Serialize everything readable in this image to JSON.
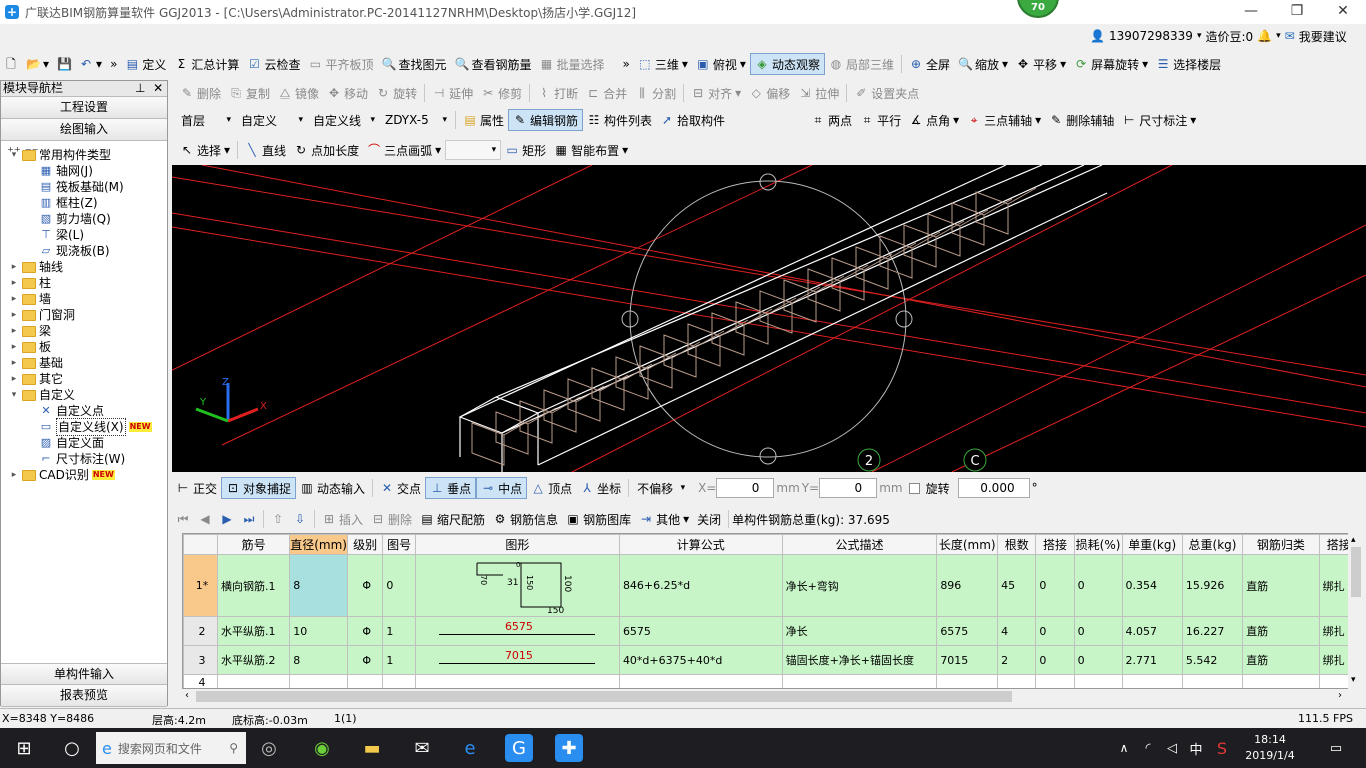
{
  "window": {
    "title": "广联达BIM钢筋算量软件 GGJ2013 - [C:\\Users\\Administrator.PC-20141127NRHM\\Desktop\\扬店小学.GGJ12]",
    "badge": "70"
  },
  "user": {
    "phone": "13907298339",
    "beans": "造价豆:0",
    "suggest": "我要建议"
  },
  "toolbar1": [
    "定义",
    "汇总计算",
    "云检查",
    "平齐板顶",
    "查找图元",
    "查看钢筋量",
    "批量选择",
    "三维",
    "俯视",
    "动态观察",
    "局部三维",
    "全屏",
    "缩放",
    "平移",
    "屏幕旋转",
    "选择楼层"
  ],
  "toolbar2": [
    "删除",
    "复制",
    "镜像",
    "移动",
    "旋转",
    "延伸",
    "修剪",
    "打断",
    "合并",
    "分割",
    "对齐",
    "偏移",
    "拉伸",
    "设置夹点"
  ],
  "toolbar3": {
    "floor": "首层",
    "type": "自定义",
    "kind": "自定义线",
    "name": "ZDYX-5",
    "items": [
      "属性",
      "编辑钢筋",
      "构件列表",
      "拾取构件"
    ],
    "aux": [
      "两点",
      "平行",
      "点角",
      "三点辅轴",
      "删除辅轴",
      "尺寸标注"
    ]
  },
  "toolbar4": [
    "选择",
    "直线",
    "点加长度",
    "三点画弧",
    "矩形",
    "智能布置"
  ],
  "nav": {
    "title": "模块导航栏",
    "btn_project": "工程设置",
    "btn_draw": "绘图输入",
    "btn_single": "单构件输入",
    "btn_report": "报表预览",
    "tree": [
      {
        "label": "常用构件类型",
        "level": 0,
        "exp": "▾",
        "kind": "folder"
      },
      {
        "label": "轴网(J)",
        "level": 1,
        "kind": "icon",
        "icon": "▦"
      },
      {
        "label": "筏板基础(M)",
        "level": 1,
        "kind": "icon",
        "icon": "▤"
      },
      {
        "label": "框柱(Z)",
        "level": 1,
        "kind": "icon",
        "icon": "▥"
      },
      {
        "label": "剪力墙(Q)",
        "level": 1,
        "kind": "icon",
        "icon": "▧"
      },
      {
        "label": "梁(L)",
        "level": 1,
        "kind": "icon",
        "icon": "⊤"
      },
      {
        "label": "现浇板(B)",
        "level": 1,
        "kind": "icon",
        "icon": "▱"
      },
      {
        "label": "轴线",
        "level": 0,
        "exp": "▸",
        "kind": "folder"
      },
      {
        "label": "柱",
        "level": 0,
        "exp": "▸",
        "kind": "folder"
      },
      {
        "label": "墙",
        "level": 0,
        "exp": "▸",
        "kind": "folder"
      },
      {
        "label": "门窗洞",
        "level": 0,
        "exp": "▸",
        "kind": "folder"
      },
      {
        "label": "梁",
        "level": 0,
        "exp": "▸",
        "kind": "folder"
      },
      {
        "label": "板",
        "level": 0,
        "exp": "▸",
        "kind": "folder"
      },
      {
        "label": "基础",
        "level": 0,
        "exp": "▸",
        "kind": "folder"
      },
      {
        "label": "其它",
        "level": 0,
        "exp": "▸",
        "kind": "folder"
      },
      {
        "label": "自定义",
        "level": 0,
        "exp": "▾",
        "kind": "folder"
      },
      {
        "label": "自定义点",
        "level": 1,
        "kind": "icon",
        "icon": "✕"
      },
      {
        "label": "自定义线(X)",
        "level": 1,
        "kind": "icon",
        "icon": "▭",
        "new": "NEW",
        "selected": true
      },
      {
        "label": "自定义面",
        "level": 1,
        "kind": "icon",
        "icon": "▨"
      },
      {
        "label": "尺寸标注(W)",
        "level": 1,
        "kind": "icon",
        "icon": "⌐"
      },
      {
        "label": "CAD识别",
        "level": 0,
        "exp": "▸",
        "kind": "folder",
        "new": "NEW"
      }
    ]
  },
  "snap": {
    "items": [
      "正交",
      "对象捕捉",
      "动态输入",
      "交点",
      "垂点",
      "中点",
      "顶点",
      "坐标"
    ],
    "offset": "不偏移",
    "x_label": "X=",
    "x_val": "0",
    "y_label": "Y=",
    "y_val": "0",
    "unit": "mm",
    "rotate": "旋转",
    "rot_val": "0.000",
    "deg": "°"
  },
  "gridtools": {
    "items": [
      "插入",
      "删除",
      "缩尺配筋",
      "钢筋信息",
      "钢筋图库",
      "其他",
      "关闭"
    ],
    "total": "单构件钢筋总重(kg): 37.695"
  },
  "table": {
    "headers": [
      "",
      "筋号",
      "直径(mm)",
      "级别",
      "图号",
      "图形",
      "计算公式",
      "公式描述",
      "长度(mm)",
      "根数",
      "搭接",
      "损耗(%)",
      "单重(kg)",
      "总重(kg)",
      "钢筋归类",
      "搭接"
    ],
    "rows": [
      [
        "1*",
        "横向钢筋.1",
        "8",
        "Φ",
        "0",
        "",
        "846+6.25*d",
        "净长+弯钩",
        "896",
        "45",
        "0",
        "0",
        "0.354",
        "15.926",
        "直筋",
        "绑扎"
      ],
      [
        "2",
        "水平纵筋.1",
        "10",
        "Φ",
        "1",
        "6575",
        "6575",
        "净长",
        "6575",
        "4",
        "0",
        "0",
        "4.057",
        "16.227",
        "直筋",
        "绑扎"
      ],
      [
        "3",
        "水平纵筋.2",
        "8",
        "Φ",
        "1",
        "7015",
        "40*d+6375+40*d",
        "锚固长度+净长+锚固长度",
        "7015",
        "2",
        "0",
        "0",
        "2.771",
        "5.542",
        "直筋",
        "绑扎"
      ],
      [
        "4",
        "",
        "",
        "",
        "",
        "",
        "",
        "",
        "",
        "",
        "",
        "",
        "",
        "",
        "",
        ""
      ]
    ],
    "shape_dims": {
      "a": "70",
      "b": "31",
      "c": "150",
      "d": "100",
      "e": "150",
      "f": "0"
    }
  },
  "viewport": {
    "axis_labels": [
      "2",
      "C"
    ],
    "axis_tripod": {
      "x": "X",
      "y": "Y",
      "z": "Z"
    }
  },
  "status": {
    "coords": "X=8348 Y=8486",
    "floor_height": "层高:4.2m",
    "base_height": "底标高:-0.03m",
    "page": "1(1)",
    "fps": "111.5 FPS"
  },
  "taskbar": {
    "search": "搜索网页和文件",
    "ime": "中",
    "time": "18:14",
    "date": "2019/1/4",
    "notif": "1"
  }
}
